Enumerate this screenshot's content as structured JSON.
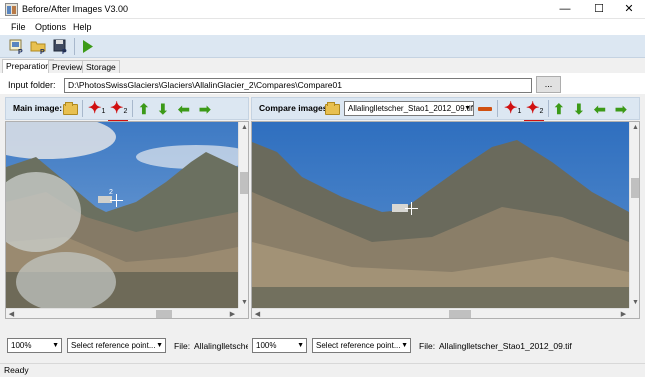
{
  "window": {
    "title": "Before/After Images V3.00",
    "minimize": "—",
    "maximize": "☐",
    "close": "✕"
  },
  "menu": {
    "items": [
      "File",
      "Options",
      "Help"
    ]
  },
  "toolbar": {
    "icons": [
      "new-project-icon",
      "open-project-icon",
      "save-project-icon",
      "run-icon"
    ]
  },
  "tabs": [
    {
      "label": "Preparation",
      "active": true
    },
    {
      "label": "Preview",
      "active": false
    },
    {
      "label": "Storage",
      "active": false
    }
  ],
  "input_folder": {
    "label": "Input folder:",
    "value": "D:\\PhotosSwissGlaciers\\Glaciers\\AllalinGlacier_2\\Compares\\Compare01",
    "browse_label": "..."
  },
  "main_pane": {
    "label": "Main image:",
    "marker_1": "1",
    "marker_2": "2",
    "crosshair_label": "2",
    "zoom": "100%",
    "reference_point": "Select reference point...",
    "file_label": "File:",
    "file_value": "Allalinglletscher_"
  },
  "compare_pane": {
    "label": "Compare images:",
    "selected_file": "Allalinglletscher_Stao1_2012_09.tif",
    "marker_1": "1",
    "marker_2": "2",
    "zoom": "100%",
    "reference_point": "Select reference point...",
    "file_label": "File:",
    "file_value": "Allalinglletscher_Stao1_2012_09.tif"
  },
  "status": {
    "text": "Ready"
  },
  "colors": {
    "accent_bar": "#dce7f2",
    "marker_red": "#d01010",
    "arrow_green": "#3c9a18",
    "sky": "#4a7fc0"
  }
}
